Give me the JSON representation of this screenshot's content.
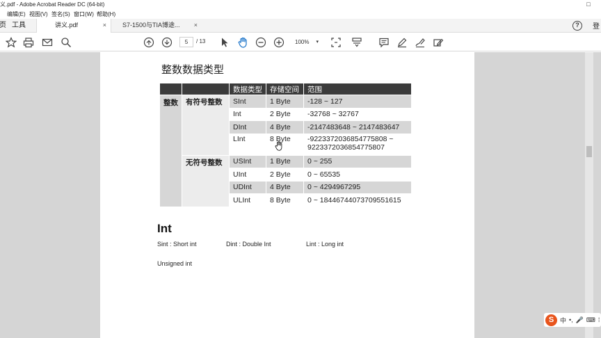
{
  "window": {
    "title": "义.pdf - Adobe Acrobat Reader DC (64-bit)",
    "maximize_glyph": "□"
  },
  "menu": [
    "编辑(E)",
    "视图(V)",
    "签名(S)",
    "窗口(W)",
    "帮助(H)"
  ],
  "tabs": {
    "tools_label": "工具",
    "tools_glyph": "页",
    "active": {
      "label": "讲义.pdf",
      "close": "×"
    },
    "inactive": {
      "label": "S7-1500与TIA博途...",
      "close": "×"
    },
    "help_glyph": "?",
    "signin": "登"
  },
  "toolbar": {
    "page_current": "5",
    "page_total": "/ 13",
    "zoom": "100%",
    "zoom_dd": "▾",
    "icons": [
      "star-icon",
      "print-icon",
      "mail-icon",
      "search-icon",
      "prev-page-icon",
      "next-page-icon",
      "pointer-icon",
      "hand-icon",
      "zoom-out-icon",
      "zoom-in-icon",
      "fit-page-icon",
      "scroll-mode-icon",
      "comment-icon",
      "highlight-icon",
      "sign-icon",
      "fill-sign-icon"
    ]
  },
  "document": {
    "heading": "整数数据类型",
    "table": {
      "headers": [
        "",
        "",
        "数据类型",
        "存储空间",
        "范围"
      ],
      "group_label": "整数",
      "signed_label": "有符号整数",
      "unsigned_label": "无符号整数",
      "signed_rows": [
        {
          "type": "SInt",
          "size": "1 Byte",
          "range": "-128 ~ 127"
        },
        {
          "type": "Int",
          "size": "2 Byte",
          "range": "-32768 ~ 32767"
        },
        {
          "type": "DInt",
          "size": "4 Byte",
          "range": "-2147483648 ~ 2147483647"
        },
        {
          "type": "LInt",
          "size": "8 Byte",
          "range": "-9223372036854775808 ~",
          "range2": "9223372036854775807"
        }
      ],
      "unsigned_rows": [
        {
          "type": "USInt",
          "size": "1 Byte",
          "range": "0 ~ 255"
        },
        {
          "type": "UInt",
          "size": "2 Byte",
          "range": "0 ~ 65535"
        },
        {
          "type": "UDInt",
          "size": "4 Byte",
          "range": "0 ~ 4294967295"
        },
        {
          "type": "ULInt",
          "size": "8 Byte",
          "range": "0 ~ 18446744073709551615"
        }
      ]
    },
    "int_title": "Int",
    "abbreviations": [
      "Sint : Short int",
      "Dint : Double Int",
      "Lint : Long int"
    ],
    "unsigned_note": "Unsigned int"
  },
  "ime": {
    "logo": "S",
    "lang": "中",
    "punct": "•,",
    "mic": "🎤",
    "keyboard": "⌨",
    "menu": "⁞"
  },
  "colors": {
    "header_bg": "#3b3b3b",
    "shade": "#d6d6d6",
    "viewer_bg": "#d5d5d5",
    "ime_logo": "#e8541c"
  }
}
